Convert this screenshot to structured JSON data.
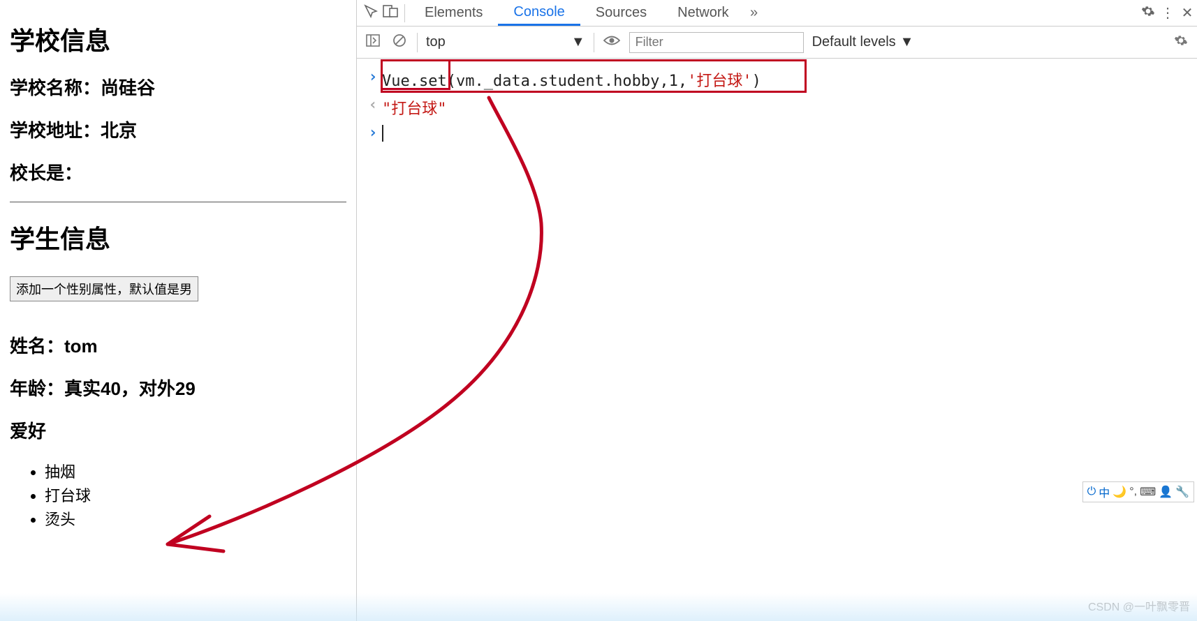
{
  "page": {
    "school_heading": "学校信息",
    "school_name_line": "学校名称：尚硅谷",
    "school_addr_line": "学校地址：北京",
    "principal_line": "校长是：",
    "student_heading": "学生信息",
    "add_gender_btn": "添加一个性别属性，默认值是男",
    "name_line": "姓名：tom",
    "age_line": "年龄：真实40，对外29",
    "hobby_heading": "爱好",
    "hobbies": [
      "抽烟",
      "打台球",
      "烫头"
    ]
  },
  "devtools": {
    "tabs": {
      "elements": "Elements",
      "console": "Console",
      "sources": "Sources",
      "network": "Network"
    },
    "toolbar": {
      "context": "top",
      "filter_placeholder": "Filter",
      "levels_label": "Default levels"
    },
    "console": {
      "input_code_prefix": "Vue.set",
      "input_code_middle": "(vm._data.student.hobby,1,",
      "input_code_str": "'打台球'",
      "input_code_suffix": ")",
      "return_value": "\"打台球\""
    }
  },
  "ime": {
    "lang": "中"
  },
  "watermark": "CSDN @一叶飘零晋"
}
